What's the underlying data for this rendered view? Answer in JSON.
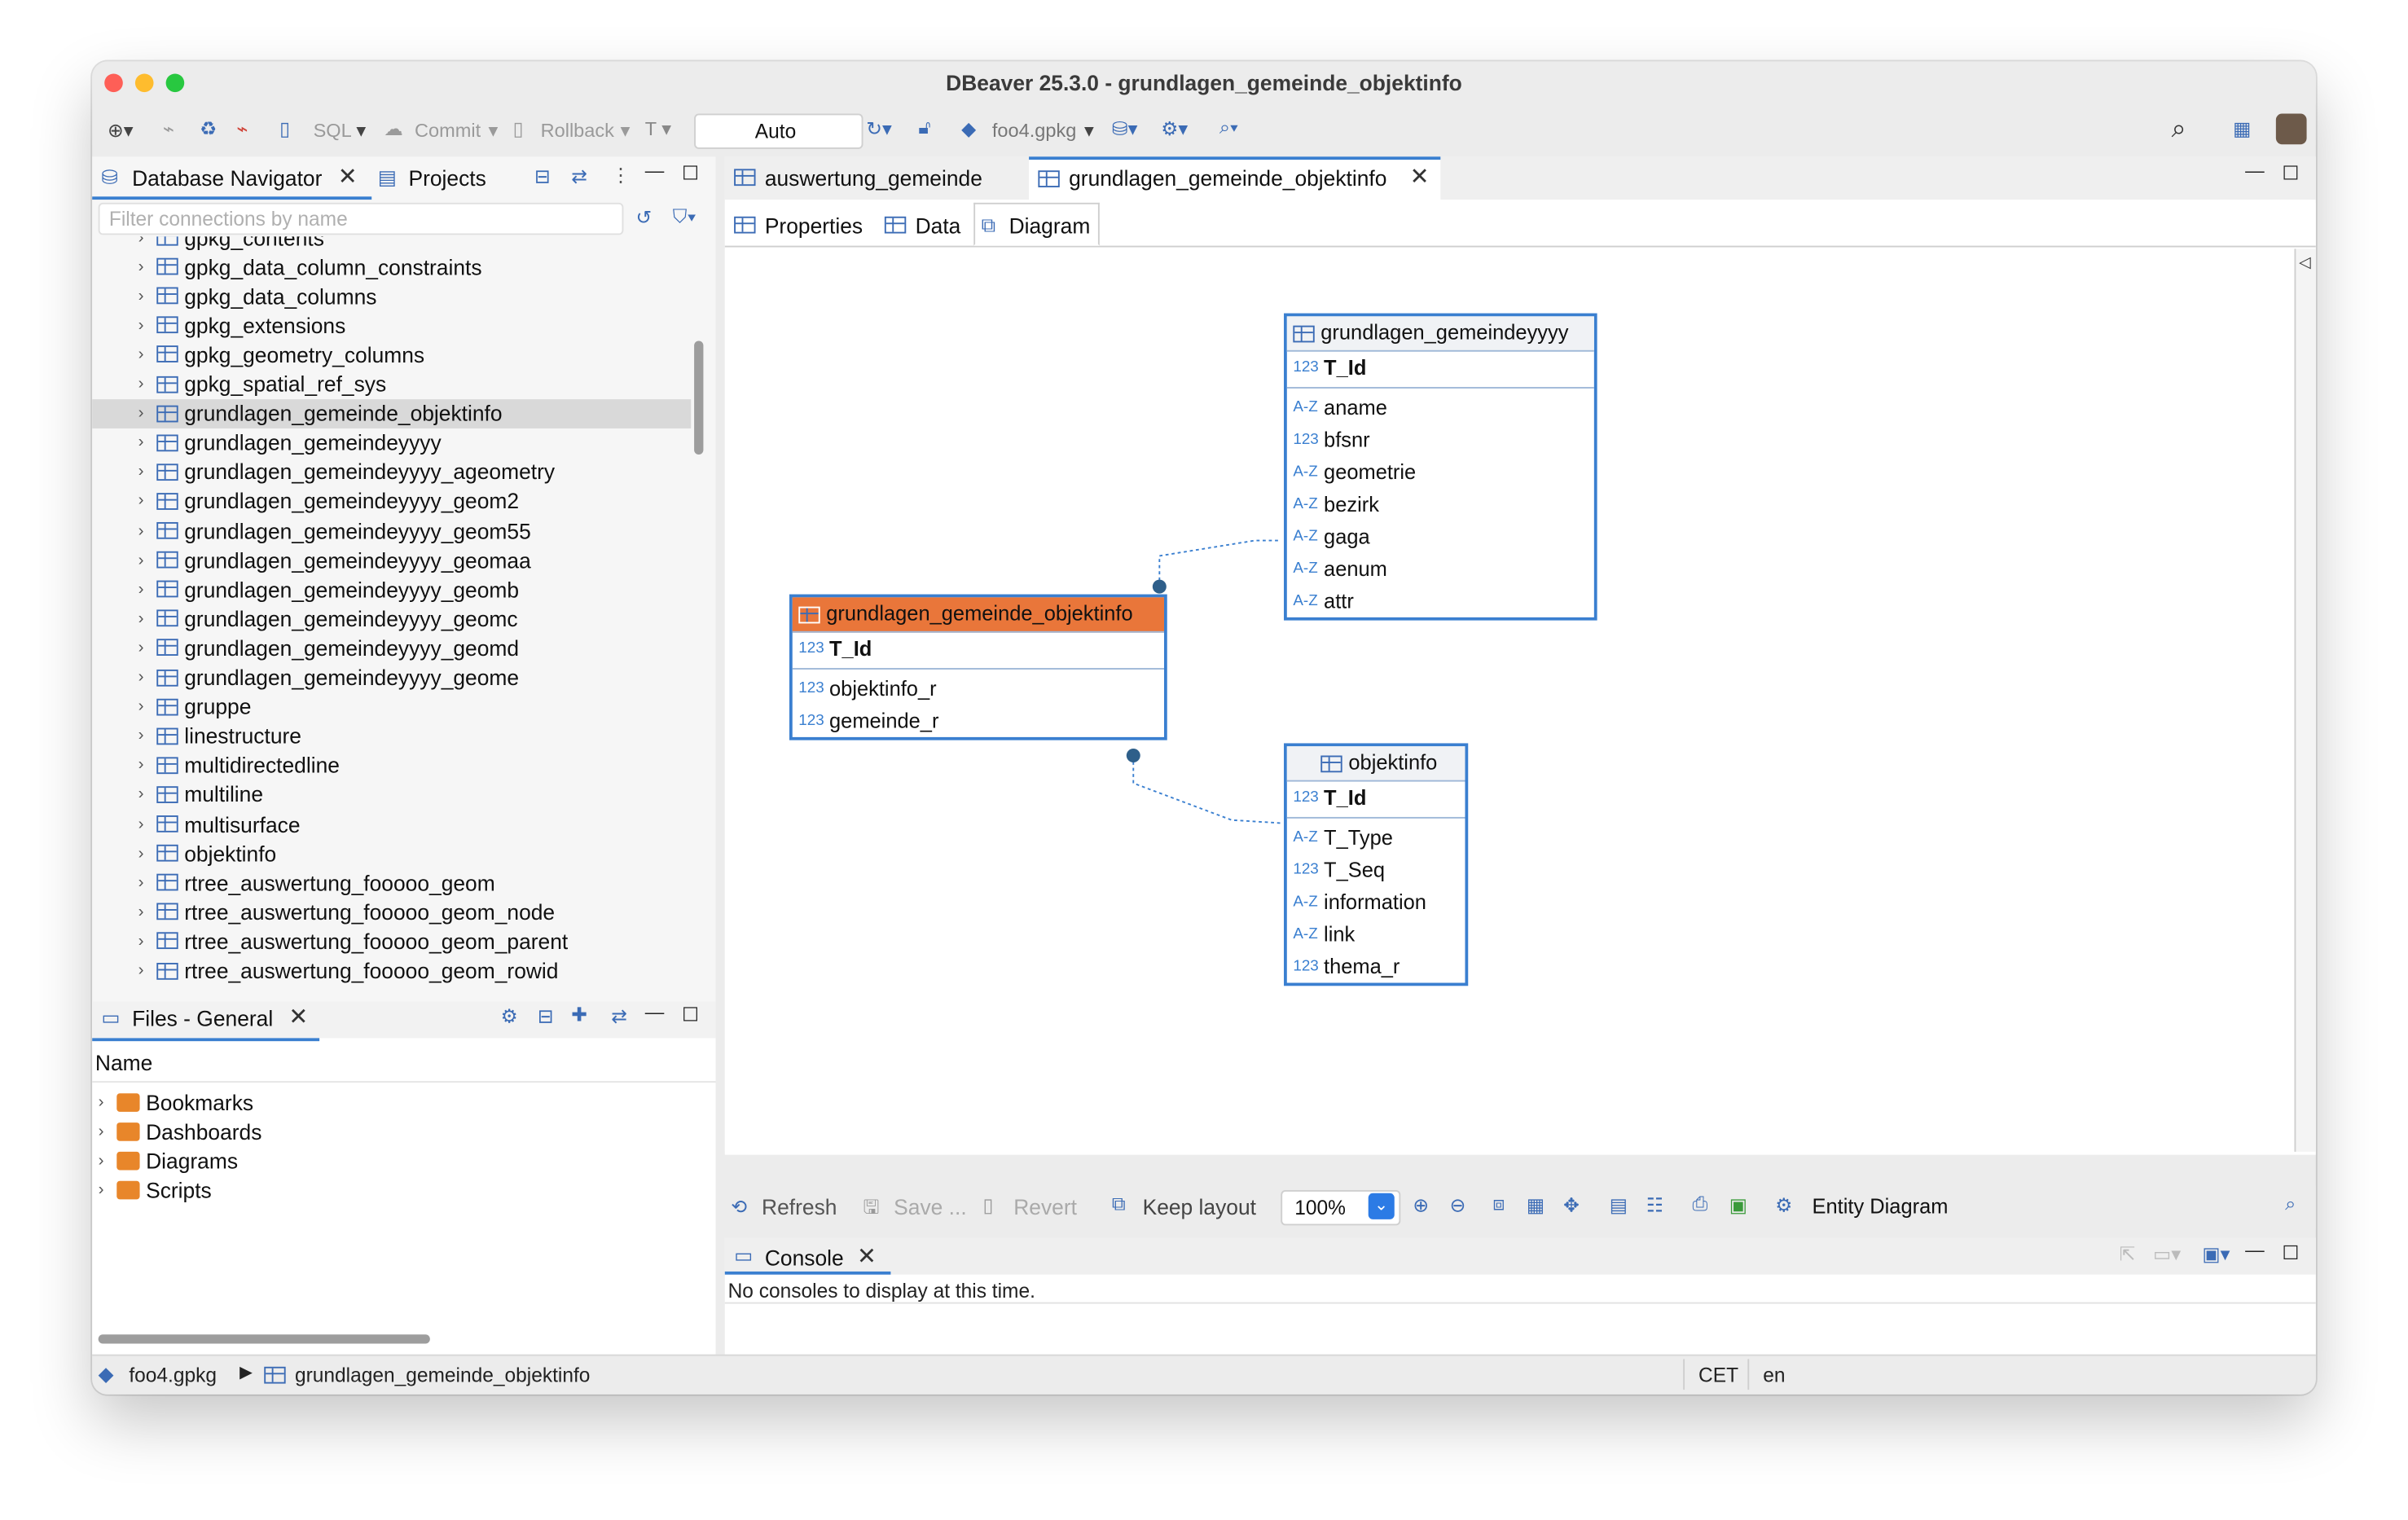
{
  "window": {
    "title": "DBeaver 25.3.0 - grundlagen_gemeinde_objektinfo"
  },
  "toolbar": {
    "sql": "SQL",
    "commit": "Commit",
    "rollback": "Rollback",
    "tx_mode": "Auto",
    "connection": "foo4.gpkg"
  },
  "navigator": {
    "tab_db": "Database Navigator",
    "tab_projects": "Projects",
    "filter_placeholder": "Filter connections by name",
    "items": [
      "gpkg_contents",
      "gpkg_data_column_constraints",
      "gpkg_data_columns",
      "gpkg_extensions",
      "gpkg_geometry_columns",
      "gpkg_spatial_ref_sys",
      "grundlagen_gemeinde_objektinfo",
      "grundlagen_gemeindeyyyy",
      "grundlagen_gemeindeyyyy_ageometry",
      "grundlagen_gemeindeyyyy_geom2",
      "grundlagen_gemeindeyyyy_geom55",
      "grundlagen_gemeindeyyyy_geomaa",
      "grundlagen_gemeindeyyyy_geomb",
      "grundlagen_gemeindeyyyy_geomc",
      "grundlagen_gemeindeyyyy_geomd",
      "grundlagen_gemeindeyyyy_geome",
      "gruppe",
      "linestructure",
      "multidirectedline",
      "multiline",
      "multisurface",
      "objektinfo",
      "rtree_auswertung_fooooo_geom",
      "rtree_auswertung_fooooo_geom_node",
      "rtree_auswertung_fooooo_geom_parent",
      "rtree_auswertung_fooooo_geom_rowid"
    ]
  },
  "files": {
    "tab": "Files - General",
    "column": "Name",
    "items": [
      "Bookmarks",
      "Dashboards",
      "Diagrams",
      "Scripts"
    ]
  },
  "editor": {
    "tabs": [
      "auswertung_gemeinde",
      "grundlagen_gemeinde_objektinfo"
    ],
    "subtabs": [
      "Properties",
      "Data",
      "Diagram"
    ]
  },
  "diagram": {
    "entities": {
      "yyyy": {
        "name": "grundlagen_gemeindeyyyy",
        "key": "T_Id",
        "cols": [
          {
            "t": "A-Z",
            "n": "aname"
          },
          {
            "t": "123",
            "n": "bfsnr"
          },
          {
            "t": "A-Z",
            "n": "geometrie"
          },
          {
            "t": "A-Z",
            "n": "bezirk"
          },
          {
            "t": "A-Z",
            "n": "gaga"
          },
          {
            "t": "A-Z",
            "n": "aenum"
          },
          {
            "t": "A-Z",
            "n": "attr"
          }
        ]
      },
      "link": {
        "name": "grundlagen_gemeinde_objektinfo",
        "key": "T_Id",
        "cols": [
          {
            "t": "123",
            "n": "objektinfo_r"
          },
          {
            "t": "123",
            "n": "gemeinde_r"
          }
        ]
      },
      "objektinfo": {
        "name": "objektinfo",
        "key": "T_Id",
        "cols": [
          {
            "t": "A-Z",
            "n": "T_Type"
          },
          {
            "t": "123",
            "n": "T_Seq"
          },
          {
            "t": "A-Z",
            "n": "information"
          },
          {
            "t": "A-Z",
            "n": "link"
          },
          {
            "t": "123",
            "n": "thema_r"
          }
        ]
      }
    },
    "toolbar": {
      "refresh": "Refresh",
      "save": "Save ...",
      "revert": "Revert",
      "keep_layout": "Keep layout",
      "zoom": "100%",
      "mode": "Entity Diagram"
    }
  },
  "console": {
    "tab": "Console",
    "message": "No consoles to display at this time."
  },
  "statusbar": {
    "connection": "foo4.gpkg",
    "object": "grundlagen_gemeinde_objektinfo",
    "timezone": "CET",
    "locale": "en"
  },
  "colors": {
    "accent": "#3a7fd0",
    "selected_entity": "#e9763a"
  }
}
